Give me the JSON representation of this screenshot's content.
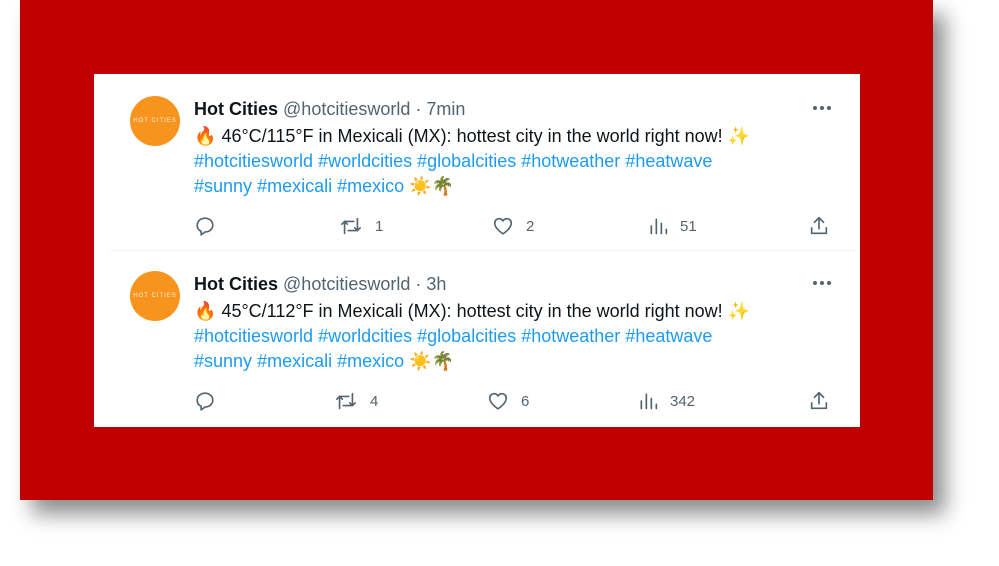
{
  "tweets": [
    {
      "avatar_text": "HOT CITIES",
      "name": "Hot Cities",
      "handle": "@hotcitiesworld",
      "separator": "·",
      "time": "7min",
      "emoji_start": "🔥",
      "text": "46°C/115°F in Mexicali (MX): hottest city in the world right now!",
      "emoji_end": "✨",
      "hashtags_line1": [
        "#hotcitiesworld",
        "#worldcities",
        "#globalcities",
        "#hotweather",
        "#heatwave"
      ],
      "hashtags_line2": [
        "#sunny",
        "#mexicali",
        "#mexico"
      ],
      "emoji_tail": "☀️🌴",
      "replies": "",
      "retweets": "1",
      "likes": "2",
      "views": "51"
    },
    {
      "avatar_text": "HOT CITIES",
      "name": "Hot Cities",
      "handle": "@hotcitiesworld",
      "separator": "·",
      "time": "3h",
      "emoji_start": "🔥",
      "text": "45°C/112°F in Mexicali (MX): hottest city in the world right now!",
      "emoji_end": "✨",
      "hashtags_line1": [
        "#hotcitiesworld",
        "#worldcities",
        "#globalcities",
        "#hotweather",
        "#heatwave"
      ],
      "hashtags_line2": [
        "#sunny",
        "#mexicali",
        "#mexico"
      ],
      "emoji_tail": "☀️🌴",
      "replies": "",
      "retweets": "4",
      "likes": "6",
      "views": "342"
    }
  ],
  "icons": {
    "more": "more-horizontal-icon",
    "reply": "reply-icon",
    "retweet": "retweet-icon",
    "like": "heart-icon",
    "views": "views-chart-icon",
    "share": "share-icon"
  },
  "colors": {
    "frame": "#c00000",
    "link": "#1d9bf0",
    "muted": "#536471",
    "text": "#0f1419",
    "avatar": "#f7941d"
  }
}
